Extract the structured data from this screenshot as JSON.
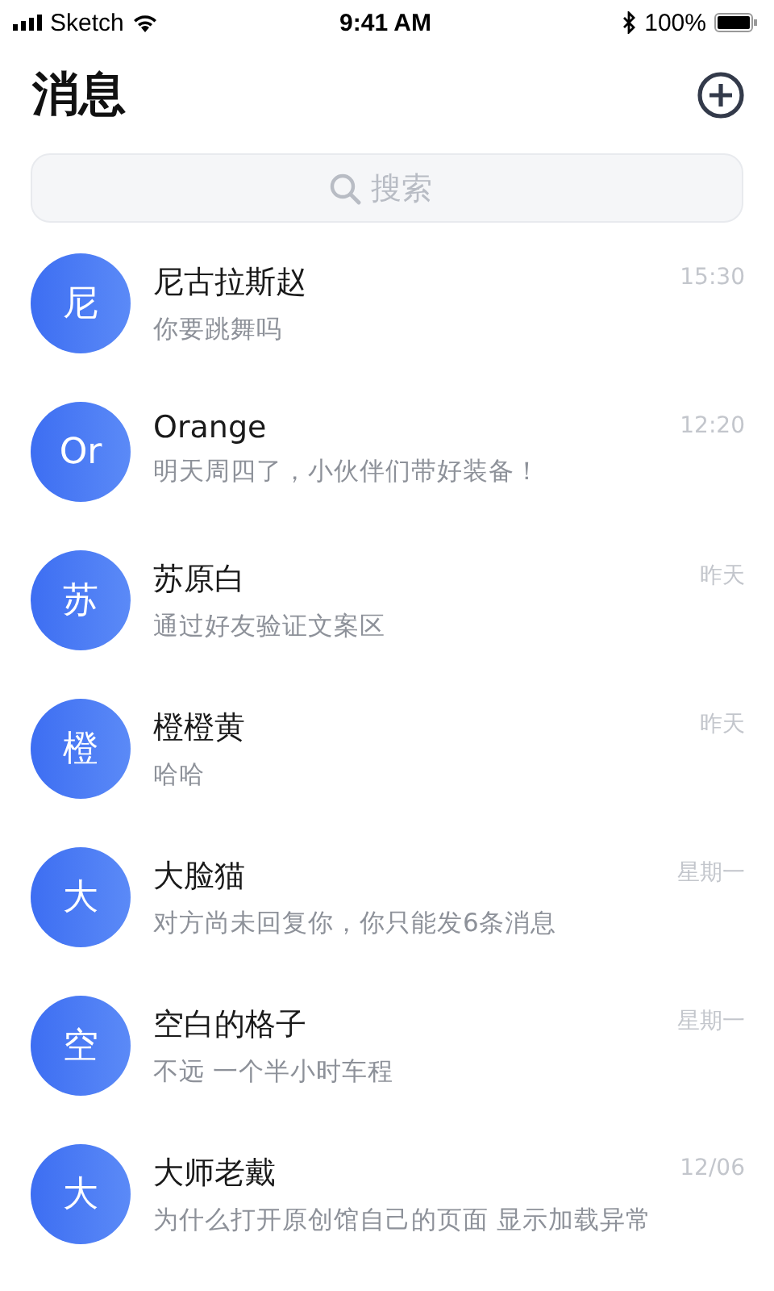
{
  "status_bar": {
    "carrier": "Sketch",
    "time": "9:41 AM",
    "battery": "100%"
  },
  "header": {
    "title": "消息"
  },
  "search": {
    "placeholder": "搜索"
  },
  "conversations": [
    {
      "avatar": "尼",
      "name": "尼古拉斯赵",
      "message": "你要跳舞吗",
      "time": "15:30"
    },
    {
      "avatar": "Or",
      "name": "Orange",
      "message": "明天周四了，小伙伴们带好装备！",
      "time": "12:20"
    },
    {
      "avatar": "苏",
      "name": "苏原白",
      "message": "通过好友验证文案区",
      "time": "昨天"
    },
    {
      "avatar": "橙",
      "name": "橙橙黄",
      "message": "哈哈",
      "time": "昨天"
    },
    {
      "avatar": "大",
      "name": "大脸猫",
      "message": "对方尚未回复你，你只能发6条消息",
      "time": "星期一"
    },
    {
      "avatar": "空",
      "name": "空白的格子",
      "message": "不远 一个半小时车程",
      "time": "星期一"
    },
    {
      "avatar": "大",
      "name": "大师老戴",
      "message": "为什么打开原创馆自己的页面 显示加载异常",
      "time": "12/06"
    }
  ]
}
